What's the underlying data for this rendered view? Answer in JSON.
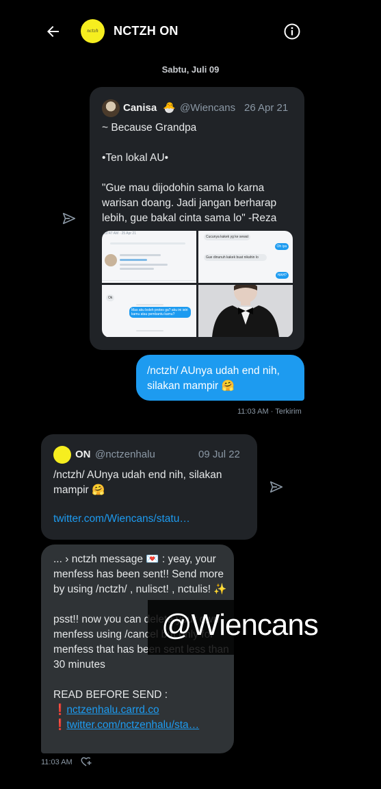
{
  "header": {
    "title": "NCTZH ON",
    "avatar_text": "nctzh"
  },
  "date_divider": "Sabtu, Juli 09",
  "quoted_tweet_1": {
    "name": "Canisa",
    "name_emoji": "🐣",
    "handle": "@Wiencans",
    "date": "26 Apr 21",
    "text": "~ Because Grandpa\n\n•Ten lokal AU•\n\n\"Gue mau dijodohin sama lo karna warisan doang. Jadi jangan berharap lebih, gue bakal cinta sama lo\" -Reza",
    "image_snippets": {
      "top_left": "10:47 AM · 25 Apr 21",
      "top_right_1": "Cucunya kakek yg ke sewat",
      "top_right_2": "Oh iya",
      "top_right_3": "Gue dinunuh kakek buat nikahin lo",
      "top_right_4": "HAH?",
      "bottom_left_1": "Ok",
      "bottom_left_2": "Mas aku boleh protes ga? aku ini istri kamu atau pembantu kamu?"
    }
  },
  "my_message": {
    "text": "/nctzh/ AUnya udah end nih, silakan mampir 🤗",
    "meta": "11:03 AM · Terkirim"
  },
  "quoted_tweet_2": {
    "name": "ON",
    "handle": "@nctzenhalu",
    "date": "09 Jul 22",
    "text": "/nctzh/ AUnya udah end nih, silakan mampir 🤗",
    "link": "twitter.com/Wiencans/statu…"
  },
  "bot_message": {
    "para1": "... › nctzh message 💌 : yeay, your menfess has been sent!! Send more by using /nctzh/ , nulisct! , nctulis! ✨",
    "para2": "psst!! now you can delete your own menfess using /cancel but only for menfess that has been sent less than 30 minutes",
    "para3": "READ BEFORE SEND :",
    "link1_prefix": "❗",
    "link1": "nctzenhalu.carrd.co",
    "link2_prefix": "❗",
    "link2": "twitter.com/nctzenhalu/sta…",
    "meta": "11:03 AM"
  },
  "watermark": "@Wiencans",
  "icons": [
    "back-arrow-icon",
    "info-icon",
    "share-dm-icon",
    "add-reaction-icon"
  ]
}
